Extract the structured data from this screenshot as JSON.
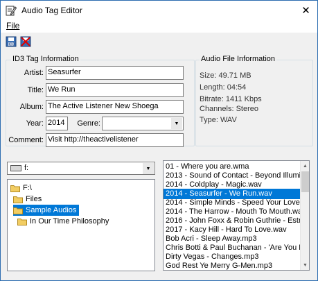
{
  "window": {
    "title": "Audio Tag Editor",
    "close_glyph": "✕"
  },
  "menu": {
    "file": "File"
  },
  "toolbar": {
    "icons": [
      "save-tag-icon",
      "delete-tag-icon"
    ]
  },
  "id3": {
    "legend": "ID3 Tag Information",
    "artist_label": "Artist:",
    "artist_value": "Seasurfer",
    "title_label": "Title:",
    "title_value": "We Run",
    "album_label": "Album:",
    "album_value": "The Active Listener New Shoega",
    "year_label": "Year:",
    "year_value": "2014",
    "genre_label": "Genre:",
    "genre_value": "",
    "comment_label": "Comment:",
    "comment_value": "Visit http://theactivelistener"
  },
  "audio_info": {
    "legend": "Audio File Information",
    "size": "Size:  49.71 MB",
    "length": "Length:  04:54",
    "bitrate": "Bitrate:  1411 Kbps",
    "channels": "Channels:  Stereo",
    "type": "Type:  WAV"
  },
  "drive": {
    "value": "f:"
  },
  "folders": [
    {
      "label": "F:\\",
      "level": 0,
      "selected": false
    },
    {
      "label": "Files",
      "level": 1,
      "selected": false
    },
    {
      "label": "Sample Audios",
      "level": 1,
      "selected": true
    },
    {
      "label": "In Our Time Philosophy",
      "level": 2,
      "selected": false
    }
  ],
  "files": [
    {
      "label": "01 - Where you are.wma",
      "selected": false
    },
    {
      "label": "2013 - Sound of Contact - Beyond Illumi",
      "selected": false
    },
    {
      "label": "2014 - Coldplay - Magic.wav",
      "selected": false
    },
    {
      "label": "2014 - Seasurfer - We Run.wav",
      "selected": true
    },
    {
      "label": "2014 - Simple Minds - Speed Your Love T",
      "selected": false
    },
    {
      "label": "2014 - The Harrow - Mouth To Mouth.wa",
      "selected": false
    },
    {
      "label": "2016 - John Foxx & Robin Guthrie - Estr",
      "selected": false
    },
    {
      "label": "2017 - Kacy Hill - Hard To Love.wav",
      "selected": false
    },
    {
      "label": "Bob Acri - Sleep Away.mp3",
      "selected": false
    },
    {
      "label": "Chris Botti & Paul Buchanan - 'Are You Lo",
      "selected": false
    },
    {
      "label": "Dirty Vegas - Changes.mp3",
      "selected": false
    },
    {
      "label": "God Rest Ye Merry G-Men.mp3",
      "selected": false
    }
  ],
  "colors": {
    "selection": "#0078d7",
    "window_bg": "#f0f0f0",
    "folder_yellow": "#f2cd62"
  }
}
